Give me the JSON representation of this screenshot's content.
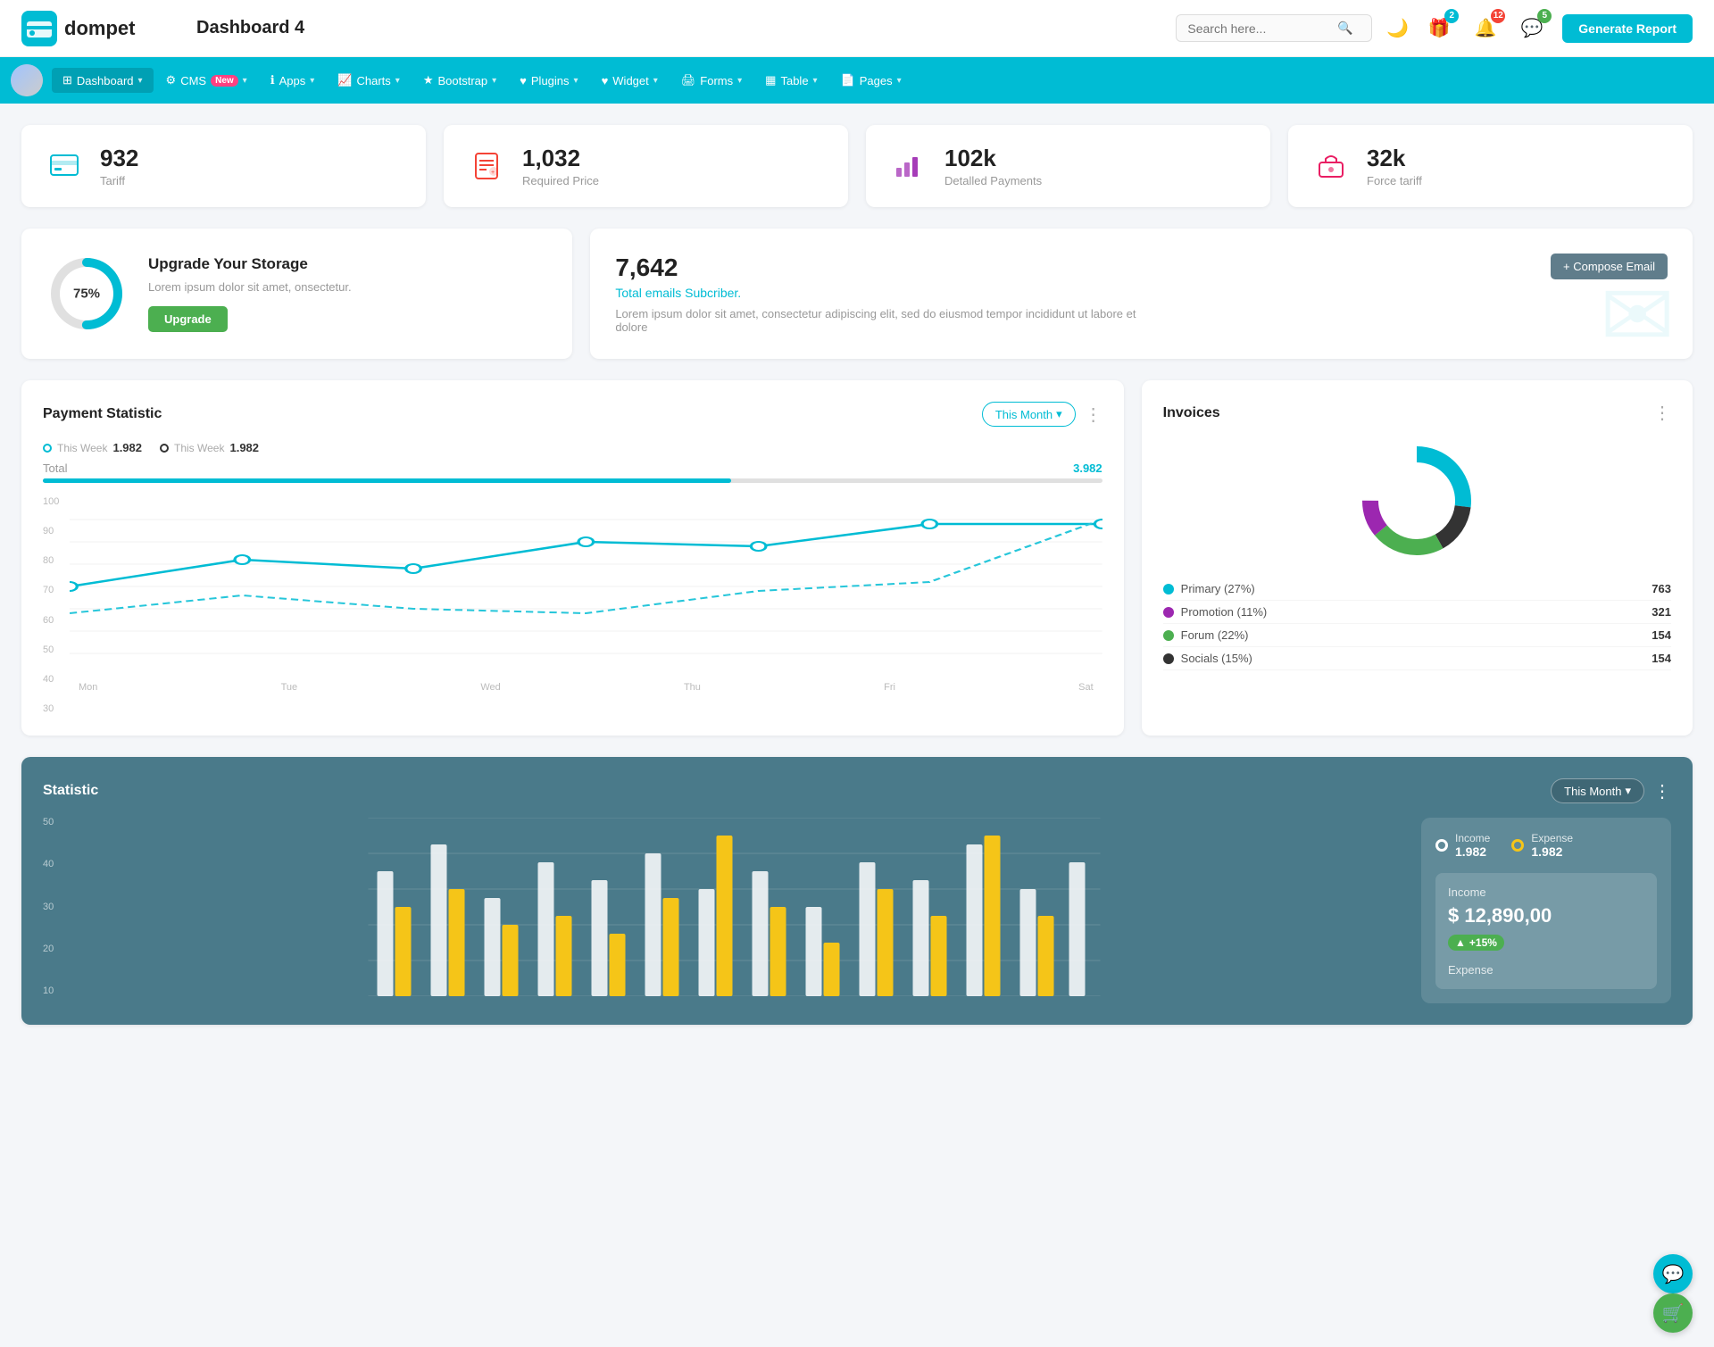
{
  "header": {
    "logo_text": "dompet",
    "title": "Dashboard 4",
    "search_placeholder": "Search here...",
    "generate_report_label": "Generate Report",
    "icons": {
      "gift_badge": "2",
      "notification_badge": "12",
      "message_badge": "5"
    }
  },
  "nav": {
    "items": [
      {
        "id": "dashboard",
        "label": "Dashboard",
        "active": true,
        "has_dropdown": true
      },
      {
        "id": "cms",
        "label": "CMS",
        "has_badge": true,
        "badge_text": "New",
        "has_dropdown": true
      },
      {
        "id": "apps",
        "label": "Apps",
        "has_dropdown": true
      },
      {
        "id": "charts",
        "label": "Charts",
        "has_dropdown": true
      },
      {
        "id": "bootstrap",
        "label": "Bootstrap",
        "has_dropdown": true
      },
      {
        "id": "plugins",
        "label": "Plugins",
        "has_dropdown": true
      },
      {
        "id": "widget",
        "label": "Widget",
        "has_dropdown": true
      },
      {
        "id": "forms",
        "label": "Forms",
        "has_dropdown": true
      },
      {
        "id": "table",
        "label": "Table",
        "has_dropdown": true
      },
      {
        "id": "pages",
        "label": "Pages",
        "has_dropdown": true
      }
    ]
  },
  "stat_cards": [
    {
      "id": "tariff",
      "value": "932",
      "label": "Tariff",
      "icon": "🗂️",
      "icon_color": "teal"
    },
    {
      "id": "required-price",
      "value": "1,032",
      "label": "Required Price",
      "icon": "📋",
      "icon_color": "red"
    },
    {
      "id": "detailed-payments",
      "value": "102k",
      "label": "Detalled Payments",
      "icon": "📊",
      "icon_color": "purple"
    },
    {
      "id": "force-tariff",
      "value": "32k",
      "label": "Force tariff",
      "icon": "🏢",
      "icon_color": "pink"
    }
  ],
  "storage": {
    "percent": "75%",
    "title": "Upgrade Your Storage",
    "description": "Lorem ipsum dolor sit amet, onsectetur.",
    "button_label": "Upgrade",
    "donut_percent": 75,
    "donut_color": "#00bcd4",
    "donut_bg": "#e0e0e0"
  },
  "email_card": {
    "count": "7,642",
    "label": "Total emails Subcriber.",
    "description": "Lorem ipsum dolor sit amet, consectetur adipiscing elit, sed do eiusmod tempor incididunt ut labore et dolore",
    "compose_label": "+ Compose Email"
  },
  "payment": {
    "title": "Payment Statistic",
    "this_month_label": "This Month",
    "legend": [
      {
        "label": "This Week",
        "value": "1.982",
        "color": "teal"
      },
      {
        "label": "This Week",
        "value": "1.982",
        "color": "dark"
      }
    ],
    "total_label": "Total",
    "total_value": "3.982",
    "progress_percent": 65,
    "x_labels": [
      "Mon",
      "Tue",
      "Wed",
      "Thu",
      "Fri",
      "Sat"
    ],
    "y_labels": [
      "100",
      "90",
      "80",
      "70",
      "60",
      "50",
      "40",
      "30"
    ]
  },
  "invoices": {
    "title": "Invoices",
    "legend": [
      {
        "label": "Primary (27%)",
        "color": "#00bcd4",
        "count": "763"
      },
      {
        "label": "Promotion (11%)",
        "color": "#9c27b0",
        "count": "321"
      },
      {
        "label": "Forum (22%)",
        "color": "#4caf50",
        "count": "154"
      },
      {
        "label": "Socials (15%)",
        "color": "#333",
        "count": "154"
      }
    ]
  },
  "statistic": {
    "title": "Statistic",
    "this_month_label": "This Month",
    "y_labels": [
      "50",
      "40",
      "30",
      "20",
      "10"
    ],
    "legend": [
      {
        "label": "Income",
        "value": "1.982",
        "dot": "white"
      },
      {
        "label": "Expense",
        "value": "1.982",
        "dot": "yellow"
      }
    ],
    "income": {
      "label": "Income",
      "value": "$ 12,890,00",
      "badge": "+15%"
    },
    "expense_label": "Expense"
  },
  "fabs": {
    "support_icon": "💬",
    "cart_icon": "🛒"
  }
}
